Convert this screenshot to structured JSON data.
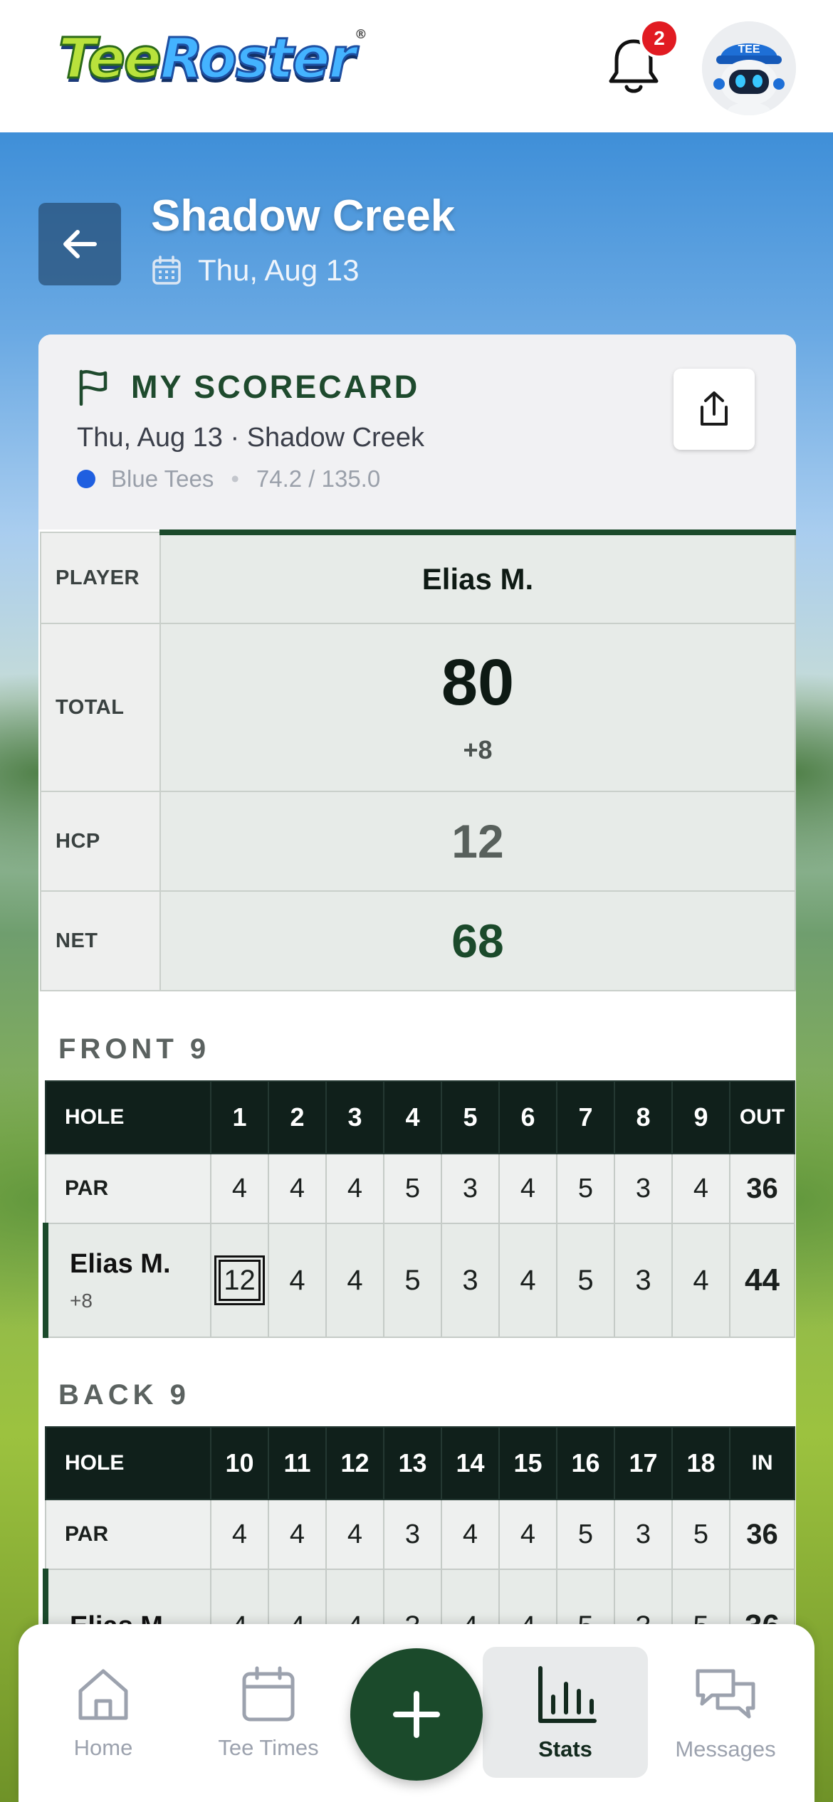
{
  "app": {
    "logo_tee": "Tee",
    "logo_roster": "Roster",
    "logo_reg": "®",
    "notification_count": "2",
    "avatar_cap_text": "TEE"
  },
  "course": {
    "title": "Shadow Creek",
    "date": "Thu, Aug 13"
  },
  "scorecard": {
    "title": "MY SCORECARD",
    "subtitle": "Thu, Aug 13 · Shadow Creek",
    "tees": "Blue Tees",
    "tees_separator": "•",
    "rating": "74.2 / 135.0",
    "tee_color": "#1f5fe0"
  },
  "summary": {
    "player_label": "PLAYER",
    "player": "Elias M.",
    "total_label": "TOTAL",
    "total": "80",
    "total_diff": "+8",
    "hcp_label": "HCP",
    "hcp": "12",
    "net_label": "NET",
    "net": "68"
  },
  "front": {
    "section": "FRONT 9",
    "hole_label": "HOLE",
    "par_label": "PAR",
    "total_label": "OUT",
    "holes": [
      "1",
      "2",
      "3",
      "4",
      "5",
      "6",
      "7",
      "8",
      "9"
    ],
    "par": [
      "4",
      "4",
      "4",
      "5",
      "3",
      "4",
      "5",
      "3",
      "4"
    ],
    "par_total": "36",
    "player": "Elias M.",
    "player_diff": "+8",
    "scores": [
      "12",
      "4",
      "4",
      "5",
      "3",
      "4",
      "5",
      "3",
      "4"
    ],
    "score_total": "44"
  },
  "back": {
    "section": "BACK 9",
    "hole_label": "HOLE",
    "par_label": "PAR",
    "total_label": "IN",
    "holes": [
      "10",
      "11",
      "12",
      "13",
      "14",
      "15",
      "16",
      "17",
      "18"
    ],
    "par": [
      "4",
      "4",
      "4",
      "3",
      "4",
      "4",
      "5",
      "3",
      "5"
    ],
    "par_total": "36",
    "player": "Elias M.",
    "scores": [
      "4",
      "4",
      "4",
      "3",
      "4",
      "4",
      "5",
      "3",
      "5"
    ],
    "score_total": "36"
  },
  "nav": {
    "home": "Home",
    "tee_times": "Tee Times",
    "stats": "Stats",
    "messages": "Messages",
    "active": "Stats"
  },
  "colors": {
    "brand_green": "#1b4a2b",
    "header_dark": "#10201b",
    "badge_red": "#e11b22"
  }
}
